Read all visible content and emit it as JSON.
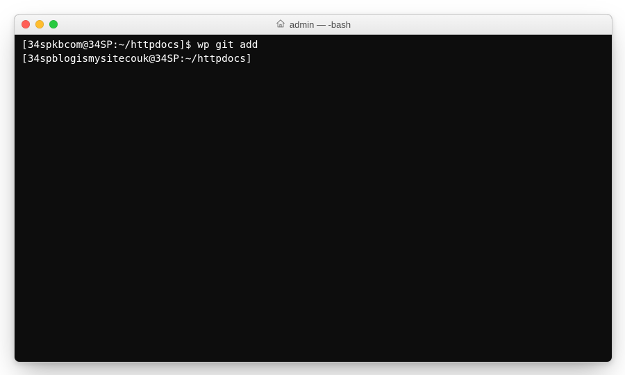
{
  "window": {
    "title": "admin — -bash",
    "icon": "home-icon"
  },
  "traffic_lights": {
    "close": "close",
    "minimize": "minimize",
    "zoom": "zoom"
  },
  "terminal": {
    "lines": [
      {
        "prompt": "[34spkbcom@34SP:~/httpdocs]$",
        "command": "wp git add"
      },
      {
        "prompt": "[34spblogismysitecouk@34SP:~/httpdocs]",
        "command": ""
      }
    ]
  }
}
